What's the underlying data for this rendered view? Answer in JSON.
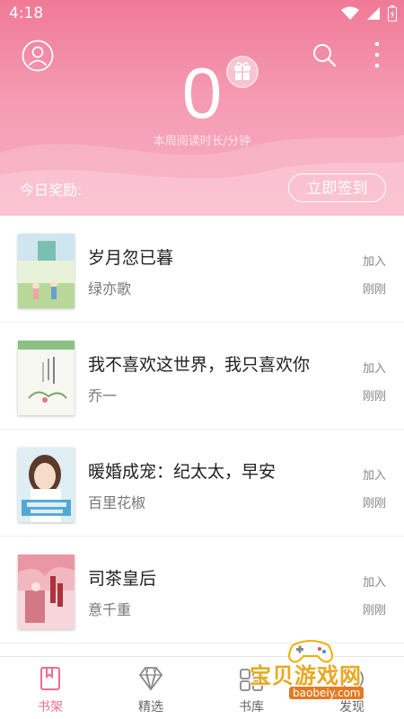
{
  "statusbar": {
    "time": "4:18"
  },
  "header": {
    "counter": "0",
    "counter_label": "本周阅读时长/分钟",
    "reward_label": "今日奖励:",
    "signin_label": "立即签到"
  },
  "books": [
    {
      "title": "岁月忽已暮",
      "author": "绿亦歌",
      "action": "加入",
      "time": "刚刚"
    },
    {
      "title": "我不喜欢这世界，我只喜欢你",
      "author": "乔一",
      "action": "加入",
      "time": "刚刚"
    },
    {
      "title": "暖婚成宠：纪太太，早安",
      "author": "百里花椒",
      "action": "加入",
      "time": "刚刚"
    },
    {
      "title": "司茶皇后",
      "author": "意千重",
      "action": "加入",
      "time": "刚刚"
    }
  ],
  "tabs": [
    {
      "label": "书架",
      "icon": "bookshelf-icon",
      "active": true
    },
    {
      "label": "精选",
      "icon": "diamond-icon",
      "active": false
    },
    {
      "label": "书库",
      "icon": "library-icon",
      "active": false
    },
    {
      "label": "发现",
      "icon": "discover-icon",
      "active": false
    }
  ],
  "watermark": {
    "text": "宝贝游戏网",
    "url": "baobeiy.com"
  },
  "colors": {
    "accent": "#ef6d8e",
    "header_top": "#f07a98",
    "header_bottom": "#f8b2c4"
  }
}
